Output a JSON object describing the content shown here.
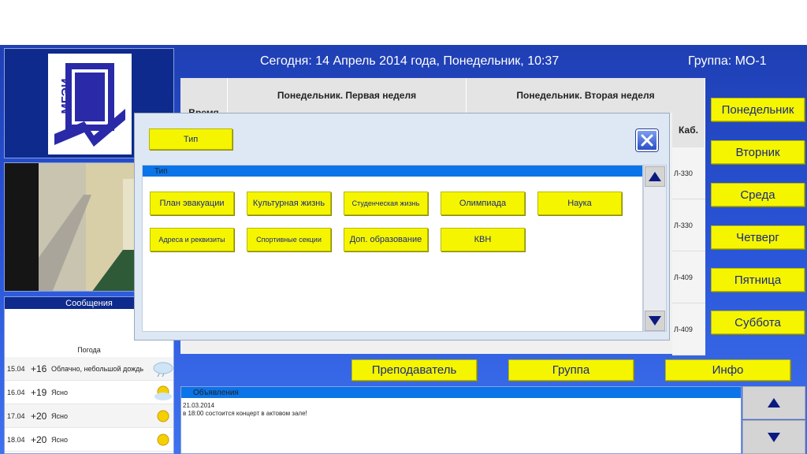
{
  "header": {
    "today": "Сегодня: 14 Апрель 2014 года, Понедельник, 10:37",
    "group": "Группа: МО-1"
  },
  "logo": {
    "text": "МГЭИ"
  },
  "messages": {
    "title": "Сообщения"
  },
  "weather": {
    "title": "Погода",
    "rows": [
      {
        "date": "15.04",
        "temp": "+16",
        "desc": "Облачно, небольшой дождь",
        "icon": "cloud-rain-icon"
      },
      {
        "date": "16.04",
        "temp": "+19",
        "desc": "Ясно",
        "icon": "sun-cloud-icon"
      },
      {
        "date": "17.04",
        "temp": "+20",
        "desc": "Ясно",
        "icon": "sun-icon"
      },
      {
        "date": "18.04",
        "temp": "+20",
        "desc": "Ясно",
        "icon": "sun-icon"
      }
    ]
  },
  "schedule": {
    "time_header": "Время",
    "week1": "Понедельник. Первая неделя",
    "week2": "Понедельник. Вторая неделя",
    "room_header": "Каб.",
    "rooms": [
      "Л-330",
      "Л-330",
      "Л-409",
      "Л-409"
    ]
  },
  "days": [
    "Понедельник",
    "Вторник",
    "Среда",
    "Четверг",
    "Пятница",
    "Суббота"
  ],
  "bottom_buttons": {
    "teacher": "Преподаватель",
    "group": "Группа",
    "info": "Инфо"
  },
  "announcements": {
    "title": "Объявления",
    "date": "21.03.2014",
    "text": "в 18:00 состоится концерт в актовом зале!"
  },
  "modal": {
    "type_button": "Тип",
    "list_title": "Тип",
    "items": [
      "План эвакуации",
      "Культурная жизнь",
      "Студенческая жизнь",
      "Олимпиада",
      "Наука",
      "Адреса и реквизиты",
      "Спортивные секции",
      "Доп. образование",
      "КВН"
    ]
  },
  "colors": {
    "accent_yellow": "#f5f500",
    "app_blue": "#2a55d8",
    "list_header": "#0a74e8"
  }
}
